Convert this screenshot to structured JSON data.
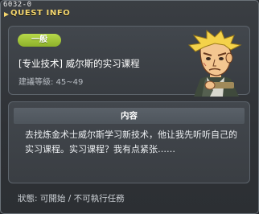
{
  "window": {
    "id_label": "6032-0",
    "title": "QUEST INFO"
  },
  "quest": {
    "badge": "一般",
    "name": "[专业技术] 威尔斯的实习课程",
    "level": "建議等級: 45~49",
    "avatar_icon": "npc-portrait-icon"
  },
  "content": {
    "header": "内容",
    "description": "去找炼金术士威尔斯学习新技术，他让我先听听自己的实习课程。实习课程？我有点紧张……"
  },
  "status": {
    "text": "狀態: 可開始 / 不可執行任務"
  },
  "colors": {
    "title": "#f5d76e",
    "badge": "#9cc432",
    "panel_border": "#5d646c"
  }
}
